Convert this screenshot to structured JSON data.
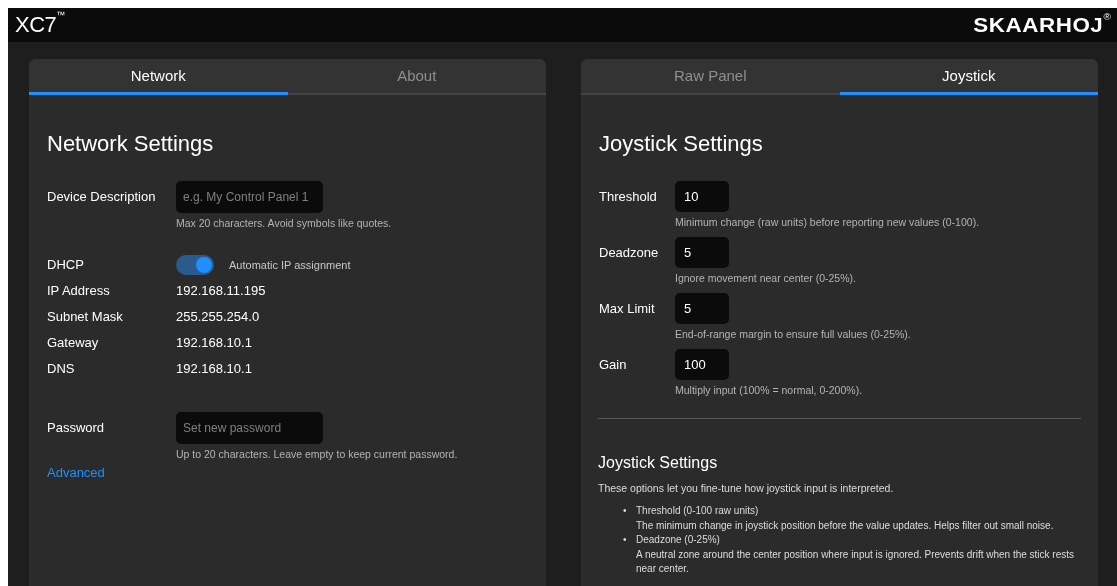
{
  "header": {
    "product": "XC7$^{™}$",
    "brand": "SKAARHOJ$^{®}$"
  },
  "left_panel": {
    "tabs": [
      {
        "label": "Network",
        "selected": true
      },
      {
        "label": "About",
        "selected": false
      }
    ],
    "title": "Network Settings",
    "rows": [
      {
        "kind": "input",
        "label": "Device Description",
        "placeholder": "e.g. My Control Panel 1",
        "hint": "Max 20 characters. Avoid symbols like quotes."
      },
      {
        "kind": "toggle",
        "label": "DHCP",
        "on": true,
        "caption": "Automatic IP assignment"
      },
      {
        "kind": "value",
        "label": "IP Address",
        "value": "192.168.11.195"
      },
      {
        "kind": "value",
        "label": "Subnet Mask",
        "value": "255.255.254.0"
      },
      {
        "kind": "value",
        "label": "Gateway",
        "value": "192.168.10.1"
      },
      {
        "kind": "value",
        "label": "DNS",
        "value": "192.168.10.1"
      },
      {
        "kind": "input",
        "label": "Password",
        "placeholder": "Set new password",
        "hint": "Up to 20 characters. Leave empty to keep current password."
      }
    ],
    "link": "Advanced"
  },
  "right_panel": {
    "tabs": [
      {
        "label": "Raw Panel",
        "selected": false
      },
      {
        "label": "Joystick",
        "selected": true
      }
    ],
    "title": "Joystick Settings",
    "fields": [
      {
        "label": "Threshold",
        "value": "10",
        "hint": "Minimum change (raw units) before reporting new values (0-100)."
      },
      {
        "label": "Deadzone",
        "value": "5",
        "hint": "Ignore movement near center (0-25%)."
      },
      {
        "label": "Max Limit",
        "value": "5",
        "hint": "End-of-range margin to ensure full values (0-25%)."
      },
      {
        "label": "Gain",
        "value": "100",
        "hint": "Multiply input (100% = normal, 0-200%)."
      }
    ],
    "help": {
      "title": "Joystick Settings",
      "intro": "These options let you fine-tune how joystick input is interpreted.",
      "items": [
        {
          "marker": "•",
          "term": "Threshold (0-100 raw units)",
          "text": "The minimum change in joystick position before the value updates. Helps filter out small noise."
        },
        {
          "marker": "•",
          "term": "Deadzone (0-25%)",
          "text": "A neutral zone around the center position where input is ignored. Prevents drift when the stick rests near center."
        }
      ]
    }
  }
}
